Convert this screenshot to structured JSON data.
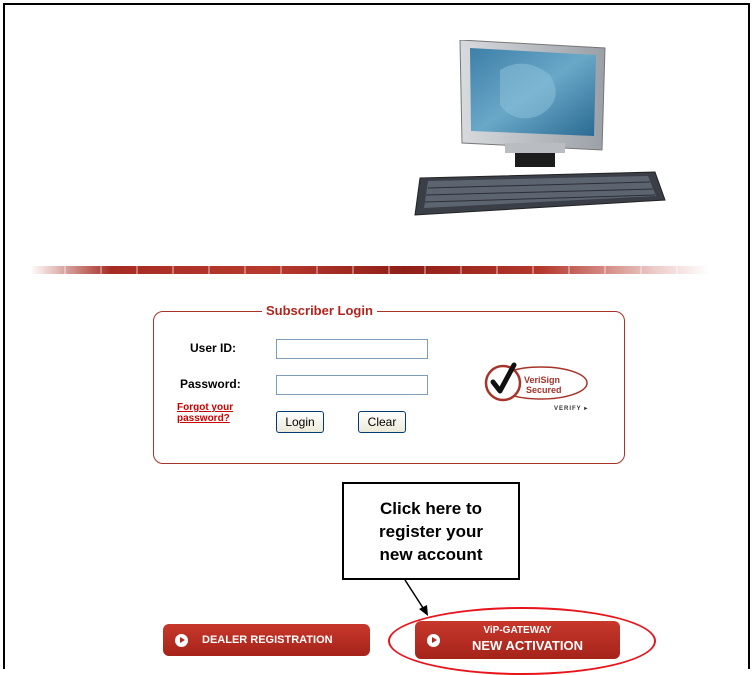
{
  "login": {
    "title": "Subscriber Login",
    "user_id_label": "User ID:",
    "user_id_value": "",
    "password_label": "Password:",
    "password_value": "",
    "forgot_line1": "Forgot your",
    "forgot_line2": "password?",
    "login_button": "Login",
    "clear_button": "Clear"
  },
  "verisign": {
    "line1": "VeriSign",
    "line2": "Secured",
    "verify": "VERIFY"
  },
  "callout": {
    "line1": "Click here to",
    "line2": "register your",
    "line3": "new account"
  },
  "buttons": {
    "dealer_registration": "DEALER REGISTRATION",
    "vip_line1": "ViP-GATEWAY",
    "vip_line2": "NEW ACTIVATION"
  },
  "colors": {
    "brand_red": "#b0261e",
    "highlight_red": "#e8141c"
  },
  "icons": [
    "computer-illustration",
    "verisign-checkmark-icon",
    "play-icon",
    "arrow-icon"
  ]
}
